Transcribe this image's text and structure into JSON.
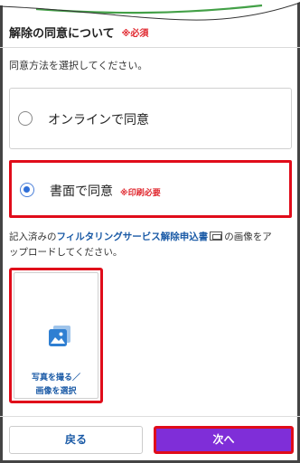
{
  "header": {
    "title": "解除の同意について",
    "required_badge": "※必須"
  },
  "instruction": "同意方法を選択してください。",
  "options": [
    {
      "label": "オンラインで同意",
      "note": "",
      "selected": false
    },
    {
      "label": "書面で同意",
      "note": "※印刷必要",
      "selected": true
    }
  ],
  "upload": {
    "prefix": "記入済みの",
    "link_label": "フィルタリングサービス解除申込書",
    "suffix": "の画像をア",
    "line2": "ップロードしてください。",
    "photo_line1": "写真を撮る／",
    "photo_line2": "画像を選択"
  },
  "footer": {
    "back_label": "戻る",
    "next_label": "次へ"
  },
  "colors": {
    "accent_purple": "#7f2ed8",
    "highlight_red": "#e00c1a",
    "link_blue": "#1a5aa6",
    "top_wave_green": "#43a047",
    "radio_blue": "#2f6fd8"
  }
}
